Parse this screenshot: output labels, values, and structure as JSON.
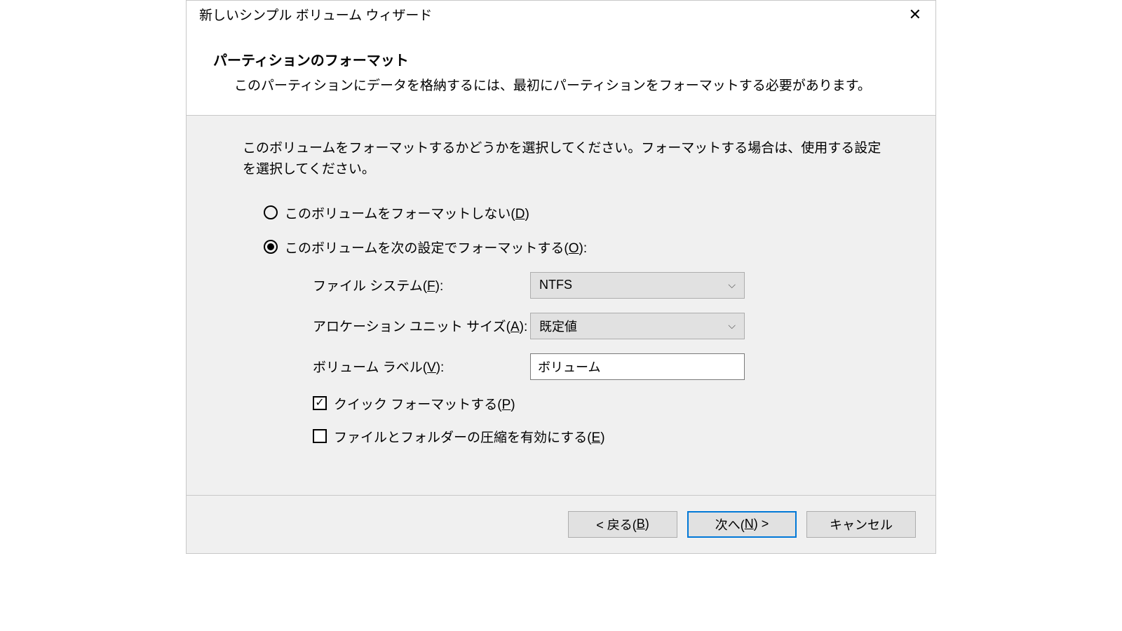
{
  "titlebar": {
    "title": "新しいシンプル ボリューム ウィザード"
  },
  "header": {
    "title": "パーティションのフォーマット",
    "subtitle": "このパーティションにデータを格納するには、最初にパーティションをフォーマットする必要があります。"
  },
  "body": {
    "instruction": "このボリュームをフォーマットするかどうかを選択してください。フォーマットする場合は、使用する設定を選択してください。",
    "radio_no_format": {
      "label_pre": "このボリュームをフォーマットしない(",
      "key": "D",
      "label_post": ")",
      "selected": false
    },
    "radio_do_format": {
      "label_pre": "このボリュームを次の設定でフォーマットする(",
      "key": "O",
      "label_post": "):",
      "selected": true
    },
    "filesystem": {
      "label_pre": "ファイル システム(",
      "key": "F",
      "label_post": "):",
      "value": "NTFS"
    },
    "allocation": {
      "label_pre": "アロケーション ユニット サイズ(",
      "key": "A",
      "label_post": "):",
      "value": "既定値"
    },
    "volume_label": {
      "label_pre": "ボリューム ラベル(",
      "key": "V",
      "label_post": "):",
      "value": "ボリューム"
    },
    "quick_format": {
      "label_pre": "クイック フォーマットする(",
      "key": "P",
      "label_post": ")",
      "checked": true
    },
    "compression": {
      "label_pre": "ファイルとフォルダーの圧縮を有効にする(",
      "key": "E",
      "label_post": ")",
      "checked": false
    }
  },
  "footer": {
    "back": {
      "pre": "< 戻る(",
      "key": "B",
      "post": ")"
    },
    "next": {
      "pre": "次へ(",
      "key": "N",
      "post": ") >"
    },
    "cancel": "キャンセル"
  }
}
